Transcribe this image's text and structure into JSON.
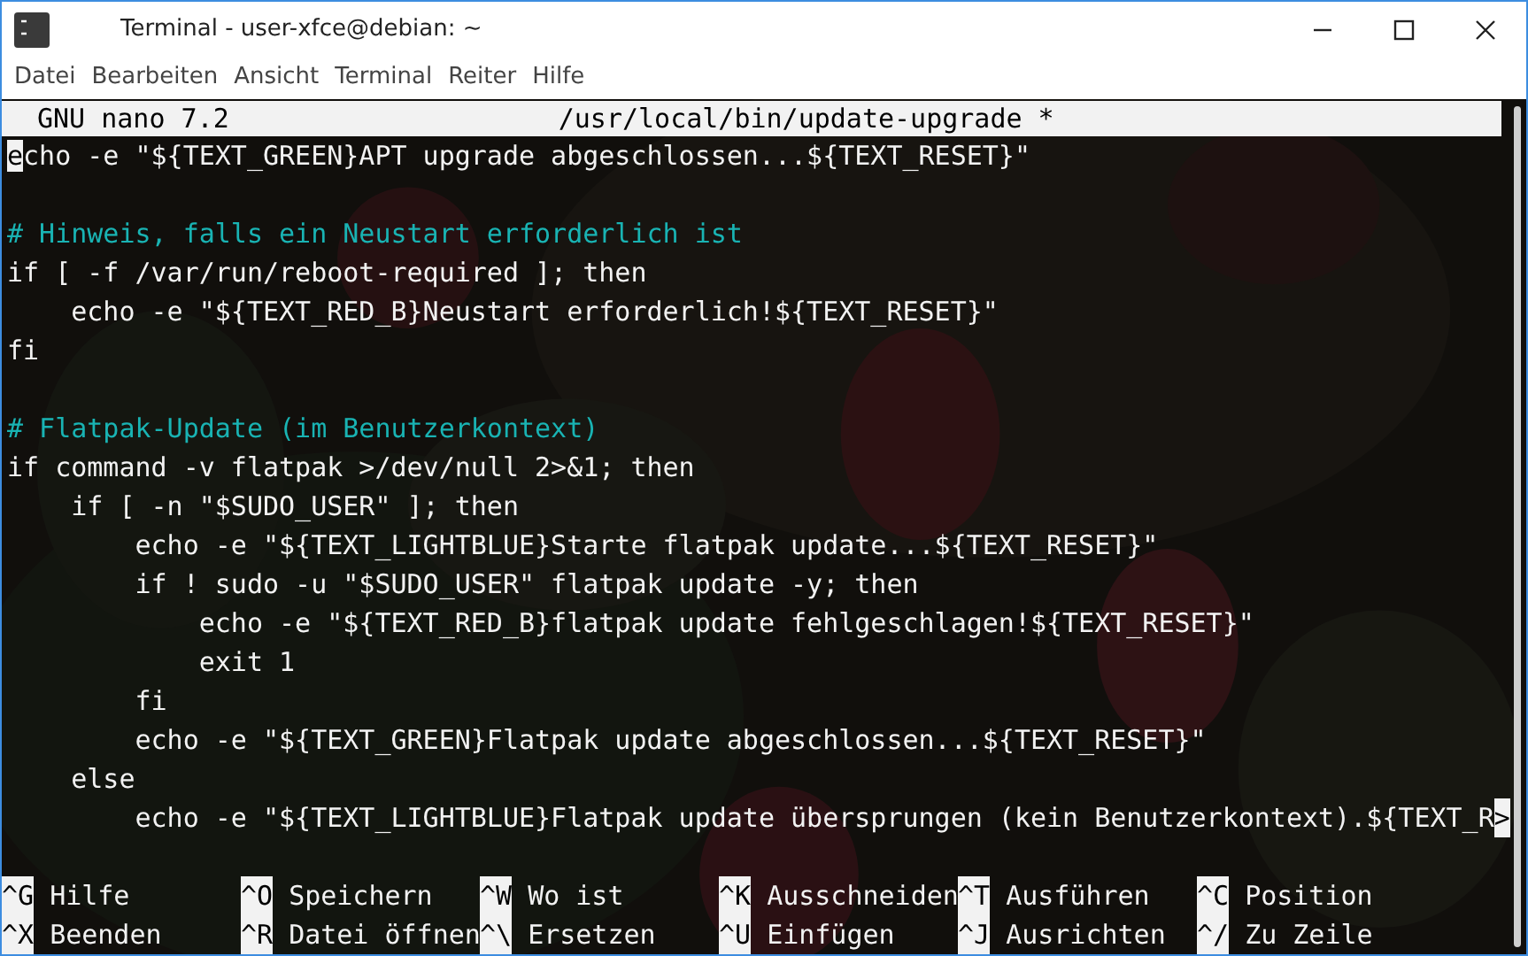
{
  "window": {
    "title": "Terminal - user-xfce@debian: ~"
  },
  "menu": [
    "Datei",
    "Bearbeiten",
    "Ansicht",
    "Terminal",
    "Reiter",
    "Hilfe"
  ],
  "nano_header": {
    "version": "GNU nano 7.2",
    "filename": "/usr/local/bin/update-upgrade *"
  },
  "lines": [
    {
      "kind": "code",
      "text": "echo -e \"${TEXT_GREEN}APT upgrade abgeschlossen...${TEXT_RESET}\"",
      "cursor": true
    },
    {
      "kind": "blank"
    },
    {
      "kind": "comment",
      "text": "# Hinweis, falls ein Neustart erforderlich ist"
    },
    {
      "kind": "code",
      "text": "if [ -f /var/run/reboot-required ]; then"
    },
    {
      "kind": "code",
      "text": "    echo -e \"${TEXT_RED_B}Neustart erforderlich!${TEXT_RESET}\""
    },
    {
      "kind": "code",
      "text": "fi"
    },
    {
      "kind": "blank"
    },
    {
      "kind": "comment",
      "text": "# Flatpak-Update (im Benutzerkontext)"
    },
    {
      "kind": "code",
      "text": "if command -v flatpak >/dev/null 2>&1; then"
    },
    {
      "kind": "code",
      "text": "    if [ -n \"$SUDO_USER\" ]; then"
    },
    {
      "kind": "code",
      "text": "        echo -e \"${TEXT_LIGHTBLUE}Starte flatpak update...${TEXT_RESET}\""
    },
    {
      "kind": "code",
      "text": "        if ! sudo -u \"$SUDO_USER\" flatpak update -y; then"
    },
    {
      "kind": "code",
      "text": "            echo -e \"${TEXT_RED_B}flatpak update fehlgeschlagen!${TEXT_RESET}\""
    },
    {
      "kind": "code",
      "text": "            exit 1"
    },
    {
      "kind": "code",
      "text": "        fi"
    },
    {
      "kind": "code",
      "text": "        echo -e \"${TEXT_GREEN}Flatpak update abgeschlossen...${TEXT_RESET}\""
    },
    {
      "kind": "code",
      "text": "    else"
    },
    {
      "kind": "code",
      "text": "        echo -e \"${TEXT_LIGHTBLUE}Flatpak update übersprungen (kein Benutzerkontext).${TEXT_R",
      "overflow": ">"
    },
    {
      "kind": "blank"
    }
  ],
  "shortcuts": [
    [
      {
        "key": "^G",
        "label": "Hilfe"
      },
      {
        "key": "^O",
        "label": "Speichern"
      },
      {
        "key": "^W",
        "label": "Wo ist"
      },
      {
        "key": "^K",
        "label": "Ausschneiden"
      },
      {
        "key": "^T",
        "label": "Ausführen"
      },
      {
        "key": "^C",
        "label": "Position"
      }
    ],
    [
      {
        "key": "^X",
        "label": "Beenden"
      },
      {
        "key": "^R",
        "label": "Datei öffnen"
      },
      {
        "key": "^\\",
        "label": "Ersetzen"
      },
      {
        "key": "^U",
        "label": "Einfügen"
      },
      {
        "key": "^J",
        "label": "Ausrichten"
      },
      {
        "key": "^/",
        "label": "Zu Zeile"
      }
    ]
  ]
}
